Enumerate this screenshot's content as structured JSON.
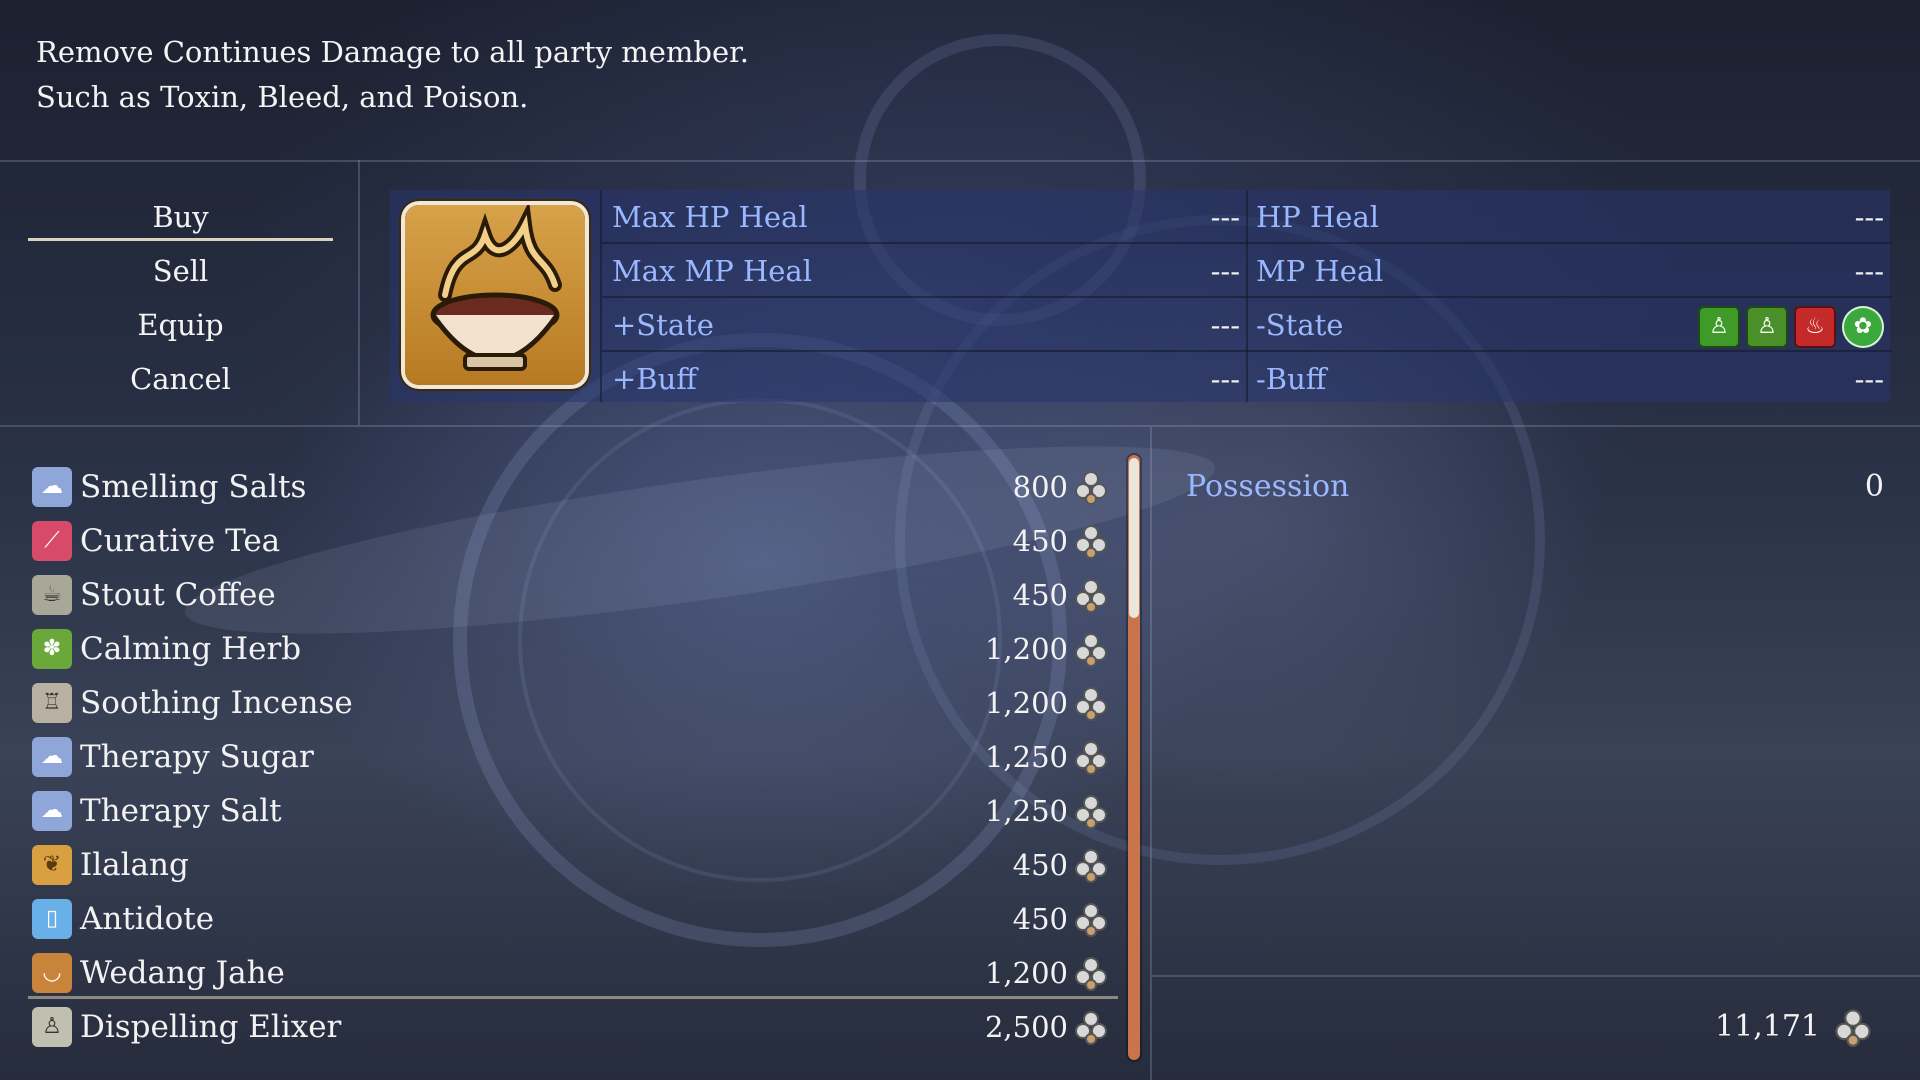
{
  "help": {
    "line1": "Remove Continues Damage to all party member.",
    "line2": "Such as Toxin, Bleed, and Poison."
  },
  "commands": [
    {
      "label": "Buy"
    },
    {
      "label": "Sell"
    },
    {
      "label": "Equip"
    },
    {
      "label": "Cancel"
    }
  ],
  "stats": {
    "max_hp_heal": {
      "label": "Max HP Heal",
      "value": "---"
    },
    "max_mp_heal": {
      "label": "Max MP Heal",
      "value": "---"
    },
    "plus_state": {
      "label": "+State",
      "value": "---"
    },
    "plus_buff": {
      "label": "+Buff",
      "value": "---"
    },
    "hp_heal": {
      "label": "HP Heal",
      "value": "---"
    },
    "mp_heal": {
      "label": "MP Heal",
      "value": "---"
    },
    "minus_state": {
      "label": "-State"
    },
    "minus_buff": {
      "label": "-Buff",
      "value": "---"
    }
  },
  "state_icons": [
    "toxin-icon",
    "bleed-icon",
    "poison-icon",
    "virus-icon"
  ],
  "items": [
    {
      "name": "Smelling Salts",
      "price": "800",
      "icon": "salts-icon"
    },
    {
      "name": "Curative Tea",
      "price": "450",
      "icon": "tea-icon"
    },
    {
      "name": "Stout Coffee",
      "price": "450",
      "icon": "coffee-icon"
    },
    {
      "name": "Calming Herb",
      "price": "1,200",
      "icon": "herb-icon"
    },
    {
      "name": "Soothing Incense",
      "price": "1,200",
      "icon": "incense-icon"
    },
    {
      "name": "Therapy Sugar",
      "price": "1,250",
      "icon": "sugar-icon"
    },
    {
      "name": "Therapy Salt",
      "price": "1,250",
      "icon": "salt-icon"
    },
    {
      "name": "Ilalang",
      "price": "450",
      "icon": "grass-icon"
    },
    {
      "name": "Antidote",
      "price": "450",
      "icon": "antidote-icon"
    },
    {
      "name": "Wedang Jahe",
      "price": "1,200",
      "icon": "bowl-icon"
    },
    {
      "name": "Dispelling Elixer",
      "price": "2,500",
      "icon": "elixir-icon"
    }
  ],
  "possession": {
    "label": "Possession",
    "value": "0"
  },
  "gold": "11,171",
  "colors": {
    "label_blue": "#9ab8ff",
    "scroll": "#c9744a",
    "panel": "#28346e"
  }
}
